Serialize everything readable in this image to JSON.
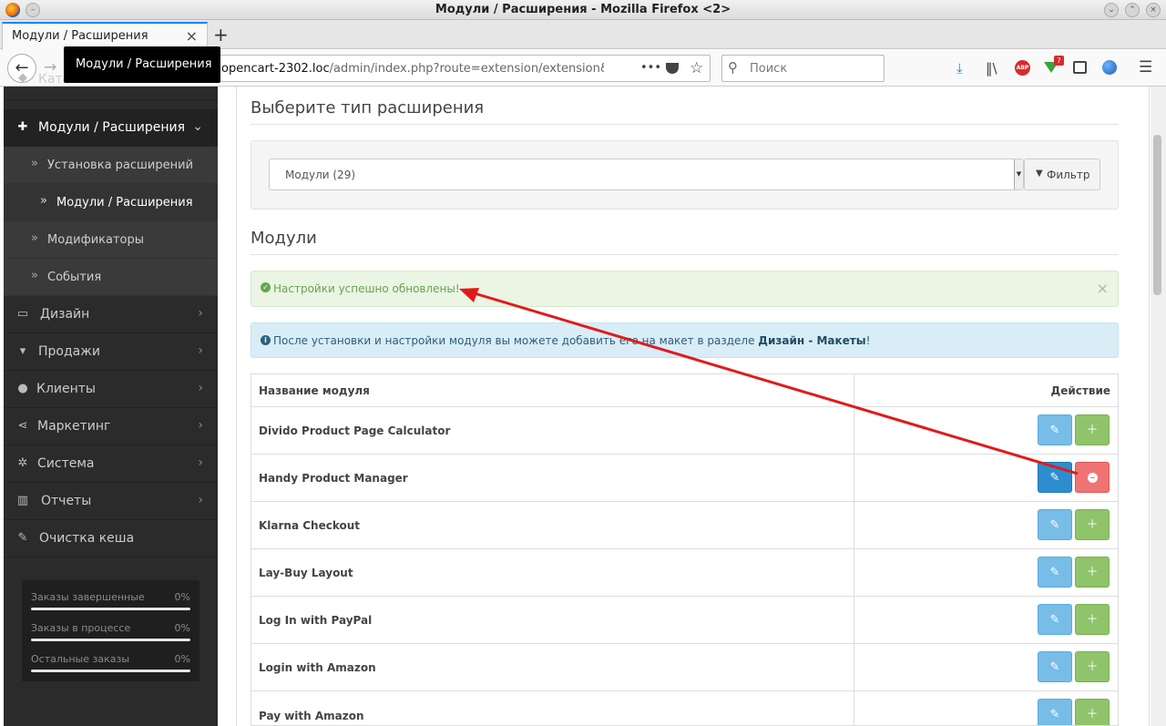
{
  "window": {
    "title": "Модули / Расширения - Mozilla Firefox <2>"
  },
  "tab": {
    "label": "Модули / Расширения",
    "close": "×"
  },
  "tooltip": {
    "text": "Модули / Расширения"
  },
  "address": {
    "host": "opencart-2302.loc",
    "path": "/admin/index.php?route=extension/extension&t",
    "more": "•••"
  },
  "search": {
    "placeholder": "Поиск"
  },
  "toolbar": {
    "abp": "ABP",
    "download_badge": "?"
  },
  "sidebar": {
    "items": [
      {
        "label": "Каталог",
        "icon": "tag-icon"
      },
      {
        "label": "Модули / Расширения",
        "icon": "puzzle-icon"
      },
      {
        "label": "Дизайн",
        "icon": "desktop-icon"
      },
      {
        "label": "Продажи",
        "icon": "cart-icon"
      },
      {
        "label": "Клиенты",
        "icon": "user-icon"
      },
      {
        "label": "Маркетинг",
        "icon": "share-icon"
      },
      {
        "label": "Система",
        "icon": "cog-icon"
      },
      {
        "label": "Отчеты",
        "icon": "bar-chart-icon"
      },
      {
        "label": "Очистка кеша",
        "icon": "brush-icon"
      }
    ],
    "subitems": [
      "Установка расширений",
      "Модули / Расширения",
      "Модификаторы",
      "События"
    ],
    "stats": [
      {
        "label": "Заказы завершенные",
        "value": "0%"
      },
      {
        "label": "Заказы в процессе",
        "value": "0%"
      },
      {
        "label": "Остальные заказы",
        "value": "0%"
      }
    ]
  },
  "main": {
    "choose_heading": "Выберите тип расширения",
    "select_value": "Модули (29)",
    "filter_button": "Фильтр",
    "modules_heading": "Модули",
    "alert_success": "Настройки успешно обновлены!",
    "alert_close": "×",
    "alert_info_pre": "После установки и настройки модуля вы можете добавить его на макет в разделе ",
    "alert_info_link": "Дизайн - Макеты",
    "alert_info_post": "!",
    "table": {
      "col_name": "Название модуля",
      "col_action": "Действие",
      "rows": [
        {
          "name": "Divido Product Page Calculator",
          "installed": false
        },
        {
          "name": "Handy Product Manager",
          "installed": true
        },
        {
          "name": "Klarna Checkout",
          "installed": false
        },
        {
          "name": "Lay-Buy Layout",
          "installed": false
        },
        {
          "name": "Log In with PayPal",
          "installed": false
        },
        {
          "name": "Login with Amazon",
          "installed": false
        },
        {
          "name": "Pay with Amazon",
          "installed": false
        }
      ]
    }
  },
  "colors": {
    "arrow": "#e01b1b",
    "sidebar_bg": "#2b2b2b",
    "edit": "#78bce8",
    "install": "#8fc46a",
    "uninstall": "#f07373"
  }
}
